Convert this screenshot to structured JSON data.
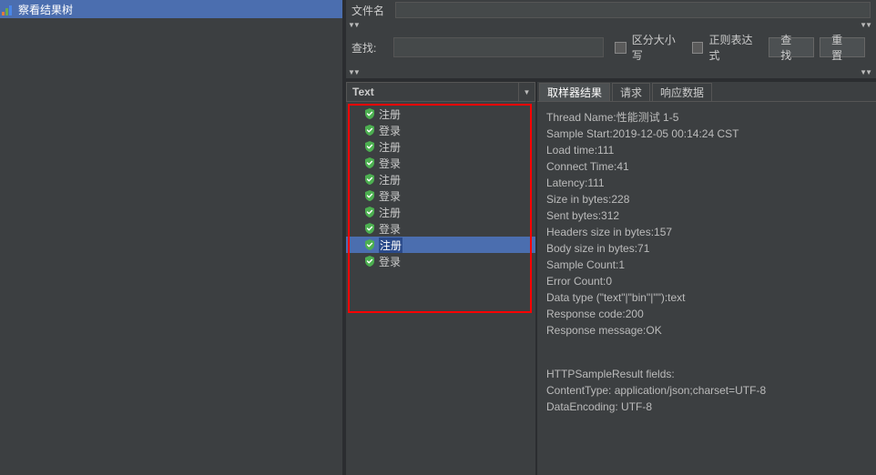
{
  "leftPanel": {
    "title": "察看结果树"
  },
  "fileName": {
    "label": "文件名"
  },
  "search": {
    "label": "查找:",
    "caseSensitiveLabel": "区分大小写",
    "regexLabel": "正则表达式",
    "searchBtn": "查找",
    "resetBtn": "重置"
  },
  "tree": {
    "header": "Text",
    "items": [
      {
        "label": "注册",
        "selected": false
      },
      {
        "label": "登录",
        "selected": false
      },
      {
        "label": "注册",
        "selected": false
      },
      {
        "label": "登录",
        "selected": false
      },
      {
        "label": "注册",
        "selected": false
      },
      {
        "label": "登录",
        "selected": false
      },
      {
        "label": "注册",
        "selected": false
      },
      {
        "label": "登录",
        "selected": false
      },
      {
        "label": "注册",
        "selected": true
      },
      {
        "label": "登录",
        "selected": false
      }
    ]
  },
  "tabs": {
    "sampler": "取样器结果",
    "request": "请求",
    "response": "响应数据"
  },
  "details": {
    "lines": [
      "Thread Name:性能测试 1-5",
      "Sample Start:2019-12-05 00:14:24 CST",
      "Load time:111",
      "Connect Time:41",
      "Latency:111",
      "Size in bytes:228",
      "Sent bytes:312",
      "Headers size in bytes:157",
      "Body size in bytes:71",
      "Sample Count:1",
      "Error Count:0",
      "Data type (\"text\"|\"bin\"|\"\"):text",
      "Response code:200",
      "Response message:OK"
    ],
    "extra": [
      "HTTPSampleResult fields:",
      "ContentType: application/json;charset=UTF-8",
      "DataEncoding: UTF-8"
    ]
  }
}
